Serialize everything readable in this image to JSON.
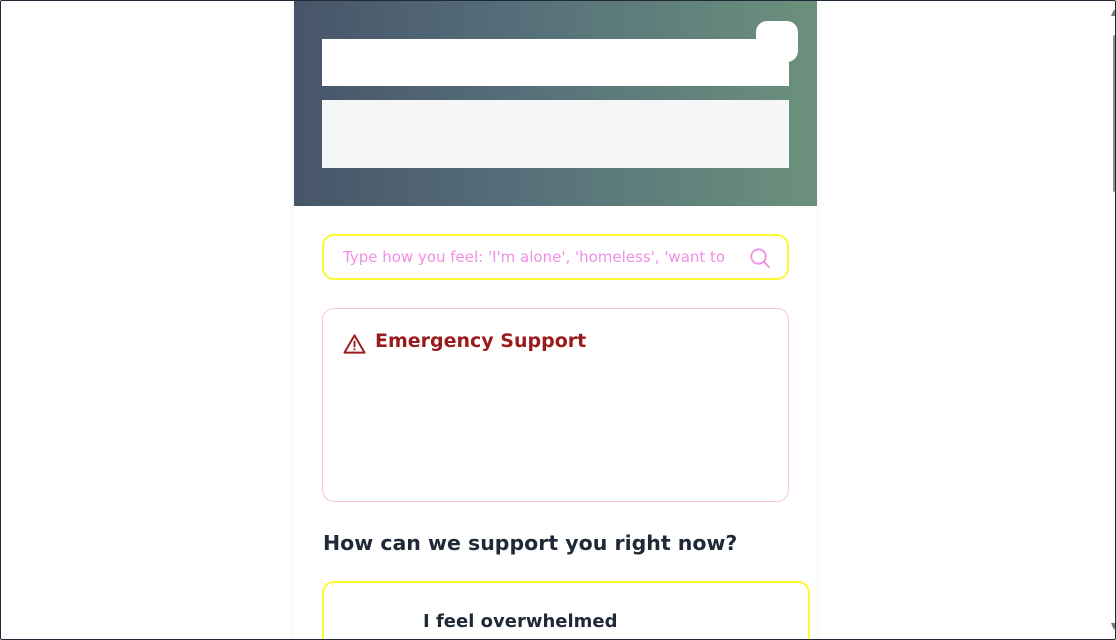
{
  "search": {
    "placeholder": "Type how you feel: 'I'm alone', 'homeless', 'want to",
    "value": ""
  },
  "emergency": {
    "title": "Emergency Support"
  },
  "support": {
    "heading": "How can we support you right now?",
    "options": [
      {
        "label": "I feel overwhelmed"
      }
    ]
  },
  "colors": {
    "header_gradient_start": "#475569",
    "header_gradient_end": "#6b917c",
    "search_border": "#fafa2e",
    "placeholder_text": "#f08ee6",
    "emergency_title": "#991b1b",
    "emergency_border": "#f6c8cd",
    "heading_text": "#1f2937"
  },
  "icons": {
    "search": "search-icon",
    "emergency": "warning-triangle-icon"
  }
}
